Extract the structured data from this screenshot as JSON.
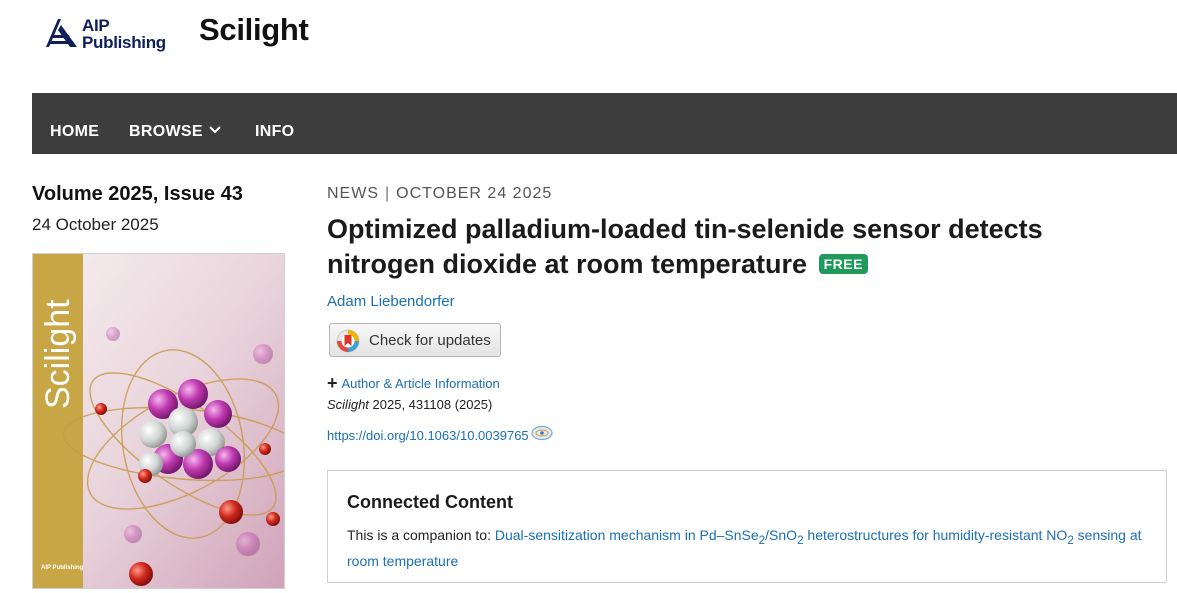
{
  "header": {
    "publisher_logo": "AIP Publishing",
    "site_title": "Scilight"
  },
  "nav": {
    "items": [
      {
        "label": "HOME"
      },
      {
        "label": "BROWSE"
      },
      {
        "label": "INFO"
      }
    ]
  },
  "issue": {
    "title": "Volume 2025, Issue 43",
    "date": "24 October 2025",
    "cover_title": "Scilight",
    "cover_publisher": "AIP Publishing"
  },
  "article": {
    "category": "NEWS",
    "separator": "|",
    "date": "OCTOBER 24 2025",
    "title": "Optimized palladium-loaded tin-selenide sensor detects nitrogen dioxide at room temperature",
    "badge": "FREE",
    "author": "Adam Liebendorfer",
    "check_updates_label": "Check for updates",
    "info_toggle_label": "Author & Article Information",
    "citation_journal": "Scilight",
    "citation_rest": " 2025, 431108 (2025)",
    "doi": "https://doi.org/10.1063/10.0039765"
  },
  "connected": {
    "heading": "Connected Content",
    "prefix": "This is a companion to: ",
    "link_part1": "Dual-sensitization mechanism in Pd–SnSe",
    "link_sub1": "2",
    "link_part2": "/SnO",
    "link_sub2": "2",
    "link_part3": " heterostructures for humidity-resistant NO",
    "link_sub3": "2",
    "link_part4": " sensing at room temperature"
  },
  "colors": {
    "nav_bg": "#3d3d3d",
    "link": "#1b6fb4",
    "free_badge": "#1f9a5a",
    "cover_spine": "#c8a646"
  }
}
